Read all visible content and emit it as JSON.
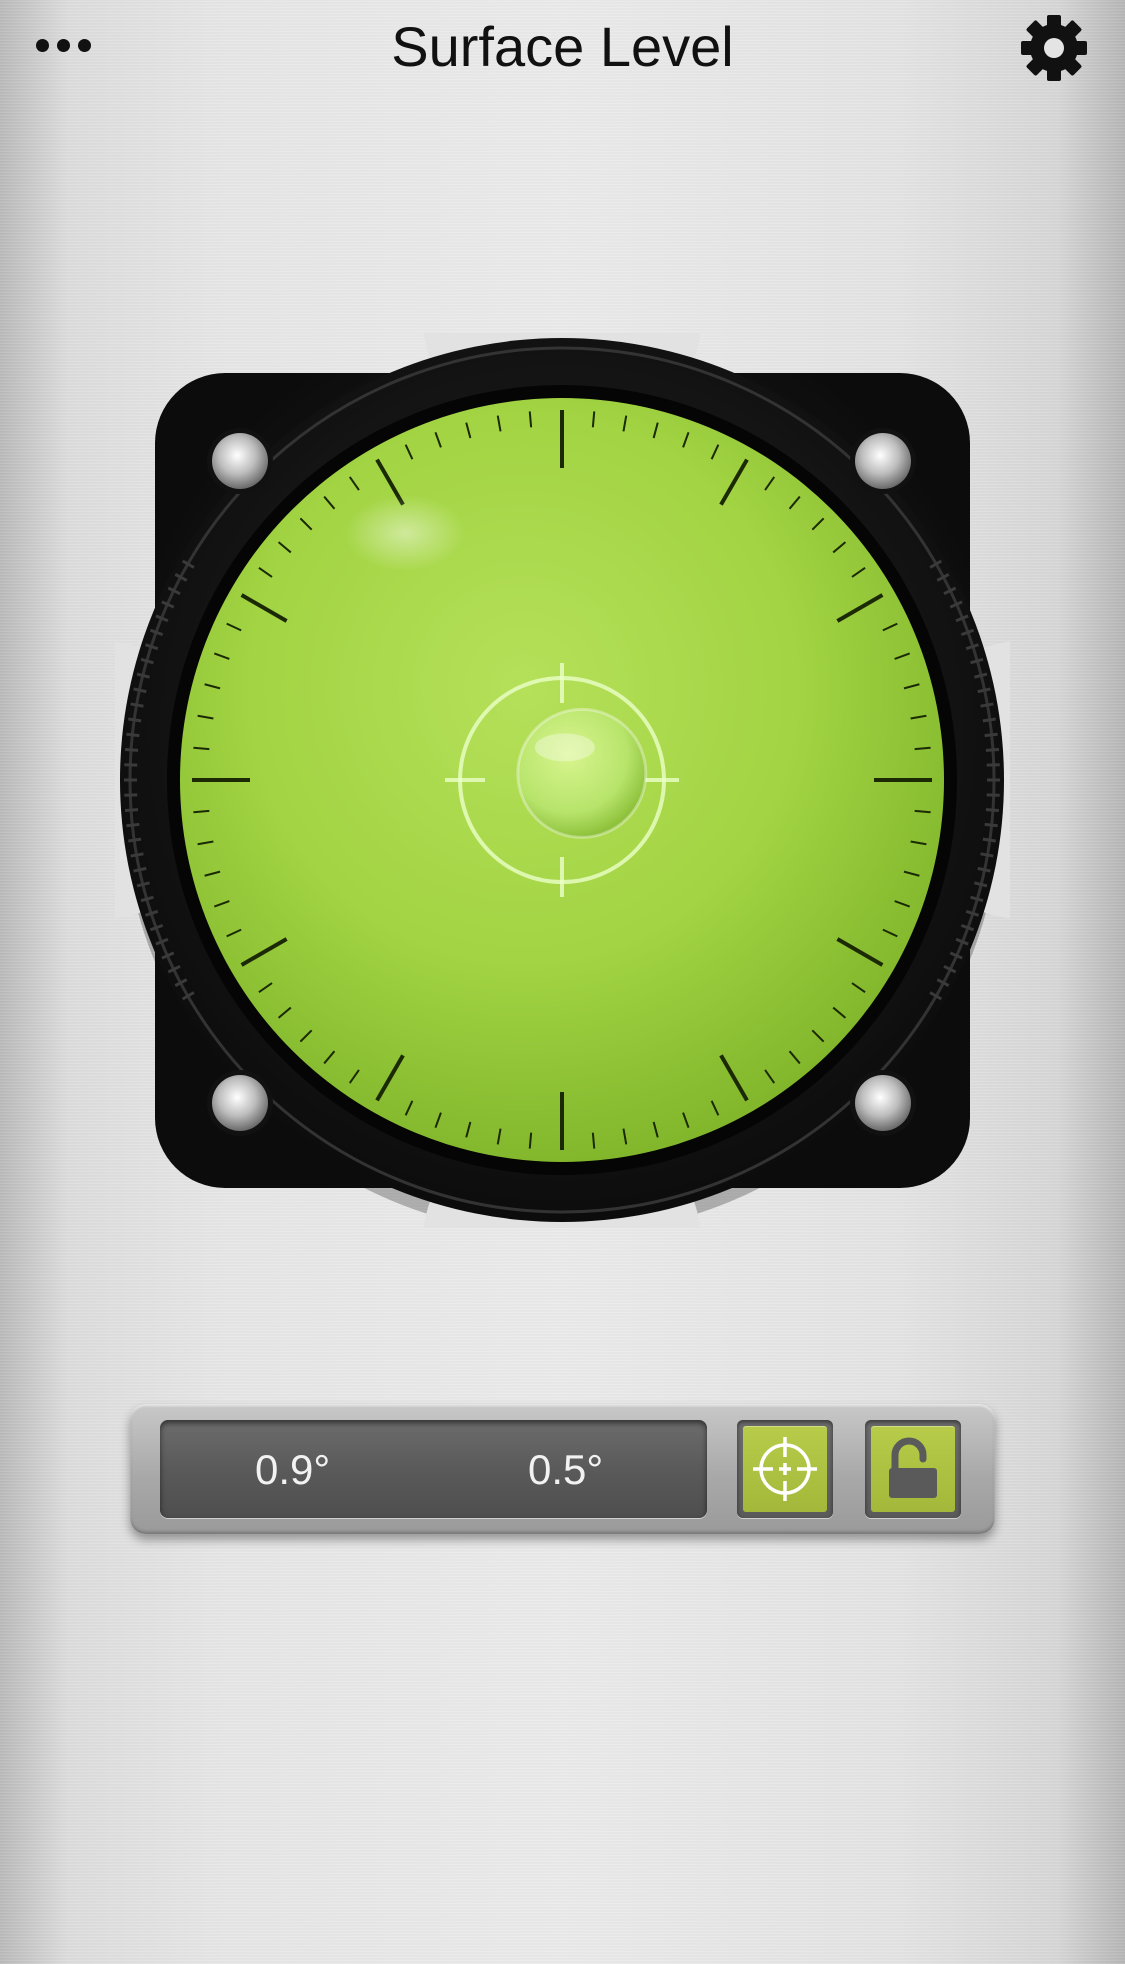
{
  "header": {
    "title": "Surface Level",
    "more_icon": "ellipsis-icon",
    "settings_icon": "gear-icon"
  },
  "level": {
    "bubble_x_deg": 0.9,
    "bubble_y_deg": 0.5,
    "fluid_color": "#9fd13a",
    "bezel_color": "#1a1a1a"
  },
  "readout": {
    "x_value": "0.9°",
    "y_value": "0.5°"
  },
  "buttons": {
    "calibrate_icon": "crosshair-icon",
    "lock_icon": "unlocked-padlock-icon",
    "accent_color": "#a8bd3d"
  }
}
